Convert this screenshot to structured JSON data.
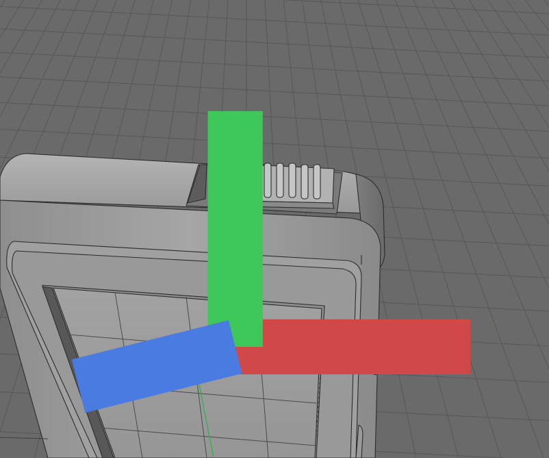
{
  "viewport": {
    "background_color": "#6a6a6a",
    "grid_color": "#575757",
    "model_base_color": "#9c9c9c",
    "model_edge_color": "#2b2b2b",
    "guide_curve_color": "#29b54a",
    "axis_colors": {
      "x": "#d04848",
      "y": "#3ec85a",
      "z": "#4a7be0"
    }
  }
}
